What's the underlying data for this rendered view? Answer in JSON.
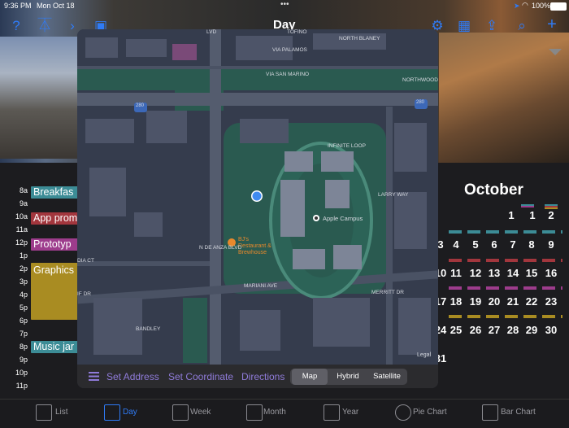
{
  "status": {
    "time": "9:36 PM",
    "date": "Mon Oct 18",
    "battery": "100%"
  },
  "header": {
    "title": "Day",
    "dots": "•••"
  },
  "calendar": {
    "times": [
      "8a",
      "9a",
      "10a",
      "11a",
      "12p",
      "1p",
      "2p",
      "3p",
      "4p",
      "5p",
      "6p",
      "7p",
      "8p",
      "9p",
      "10p",
      "11p"
    ],
    "events": [
      {
        "label": "Breakfas",
        "color": "#3c8c96"
      },
      {
        "label": "App prom",
        "color": "#a2363d"
      },
      {
        "label": "Prototyp",
        "color": "#9d3c8c"
      },
      {
        "label": "Graphics",
        "color": "#a98c22"
      },
      {
        "label": "Music jar",
        "color": "#3c8c96"
      }
    ]
  },
  "month": {
    "title": "October",
    "days": [
      "1",
      "2",
      "3",
      "4",
      "5",
      "6",
      "7",
      "8",
      "9",
      "10",
      "11",
      "12",
      "13",
      "14",
      "15",
      "16",
      "17",
      "18",
      "19",
      "20",
      "21",
      "22",
      "23",
      "24",
      "25",
      "26",
      "27",
      "28",
      "29",
      "30",
      "31"
    ]
  },
  "map": {
    "streets": {
      "lvd": "LVD",
      "infinite_loop": "INFINITE LOOP",
      "via_palamos": "VIA PALAMOS",
      "via_san_marino": "VIA SAN MARINO",
      "northwood": "NORTHWOOD",
      "larry_way": "LARRY WAY",
      "n_de_anza": "N DE ANZA BLVD",
      "mariani": "MARIANI AVE",
      "merritt": "MERRITT DR",
      "bandley": "BANDLEY",
      "north_blaney": "NORTH BLANEY",
      "dia_ct": "DIA CT",
      "if_dr": "IF DR",
      "tofino": "TOFINO"
    },
    "highway": "280",
    "poi_apple": "Apple Campus",
    "poi_restaurant_1": "BJ's",
    "poi_restaurant_2": "Restaurant &",
    "poi_restaurant_3": "Brewhouse",
    "legal": "Legal",
    "toolbar": {
      "set_address": "Set Address",
      "set_coordinate": "Set Coordinate",
      "directions": "Directions"
    },
    "modes": [
      "Map",
      "Hybrid",
      "Satellite"
    ],
    "selected_mode": "Map"
  },
  "tabs": [
    "List",
    "Day",
    "Week",
    "Month",
    "Year",
    "Pie Chart",
    "Bar Chart"
  ],
  "selected_tab": "Day"
}
